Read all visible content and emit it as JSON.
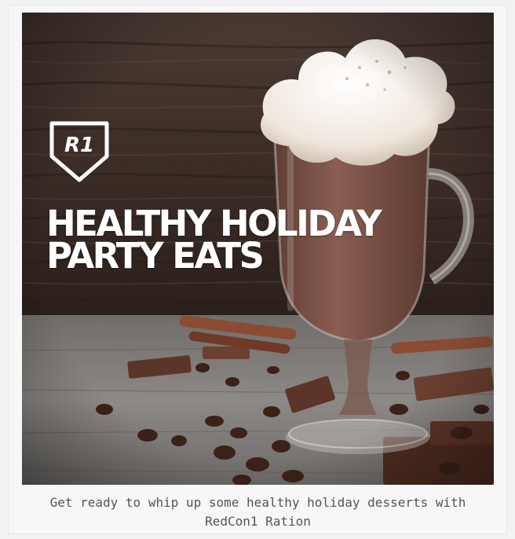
{
  "hero": {
    "logo_text": "R1",
    "headline_line1": "HEALTHY HOLIDAY",
    "headline_line2": "PARTY EATS"
  },
  "caption": "Get ready to whip up some healthy holiday desserts with RedCon1 Ration",
  "colors": {
    "wood_dark": "#3a2b24",
    "table_light": "#8a8a8a",
    "cocoa": "#7b5044",
    "cream": "#f3eee8"
  }
}
